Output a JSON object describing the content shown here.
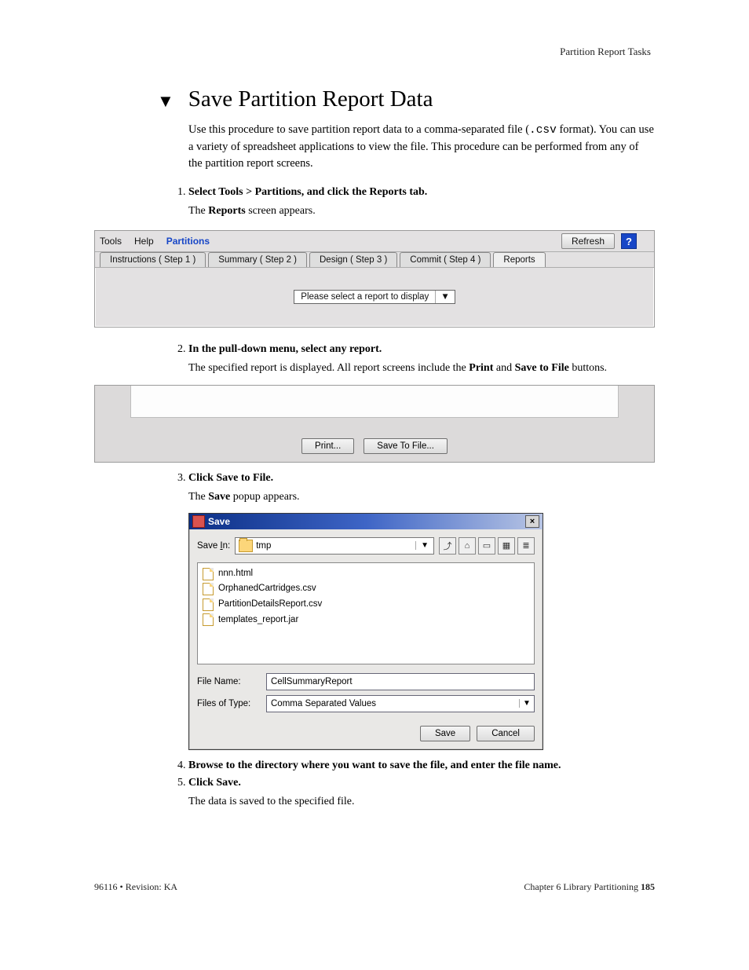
{
  "running_header": "Partition Report Tasks",
  "title": "Save Partition Report Data",
  "intro_parts": {
    "a": "Use this procedure to save partition report data to a comma-separated file (",
    "ext": ".csv",
    "b": " format). You can use a variety of spreadsheet applications to view the file. This procedure can be performed from any of the partition report screens."
  },
  "steps": {
    "s1": {
      "lead": "Select Tools > Partitions, and click the Reports tab.",
      "follow_a": "The ",
      "follow_bold": "Reports",
      "follow_b": " screen appears."
    },
    "s2": {
      "lead": "In the pull-down menu, select any report.",
      "follow_a": "The specified report is displayed. All report screens include the ",
      "follow_bold1": "Print",
      "follow_mid": " and ",
      "follow_bold2": "Save to File",
      "follow_b": " buttons."
    },
    "s3": {
      "lead": "Click Save to File.",
      "follow_a": "The ",
      "follow_bold": "Save",
      "follow_b": " popup appears."
    },
    "s4": {
      "lead": "Browse to the directory where you want to save the file, and enter the file name."
    },
    "s5": {
      "lead": "Click Save.",
      "follow": "The data is saved to the specified file."
    }
  },
  "app1": {
    "menu": {
      "tools": "Tools",
      "help": "Help",
      "partitions": "Partitions"
    },
    "refresh": "Refresh",
    "help_icon": "?",
    "tabs": [
      "Instructions ( Step 1 )",
      "Summary ( Step 2 )",
      "Design ( Step 3 )",
      "Commit ( Step 4 )",
      "Reports"
    ],
    "combo": "Please select a report to display"
  },
  "app2": {
    "print": "Print...",
    "save": "Save To File..."
  },
  "savedlg": {
    "title": "Save",
    "close": "×",
    "save_in_label": "Save In:",
    "save_in_under": "I",
    "folder": "tmp",
    "files": [
      "nnn.html",
      "OrphanedCartridges.csv",
      "PartitionDetailsReport.csv",
      "templates_report.jar"
    ],
    "filename_label": "File Name:",
    "filename_under": "N",
    "filename_value": "CellSummaryReport",
    "type_label": "Files of Type:",
    "type_under": "T",
    "type_value": "Comma Separated Values",
    "save_btn": "Save",
    "cancel_btn": "Cancel"
  },
  "footer": {
    "left": "96116 • Revision: KA",
    "right_a": "Chapter 6 Library Partitioning   ",
    "page": "185"
  }
}
